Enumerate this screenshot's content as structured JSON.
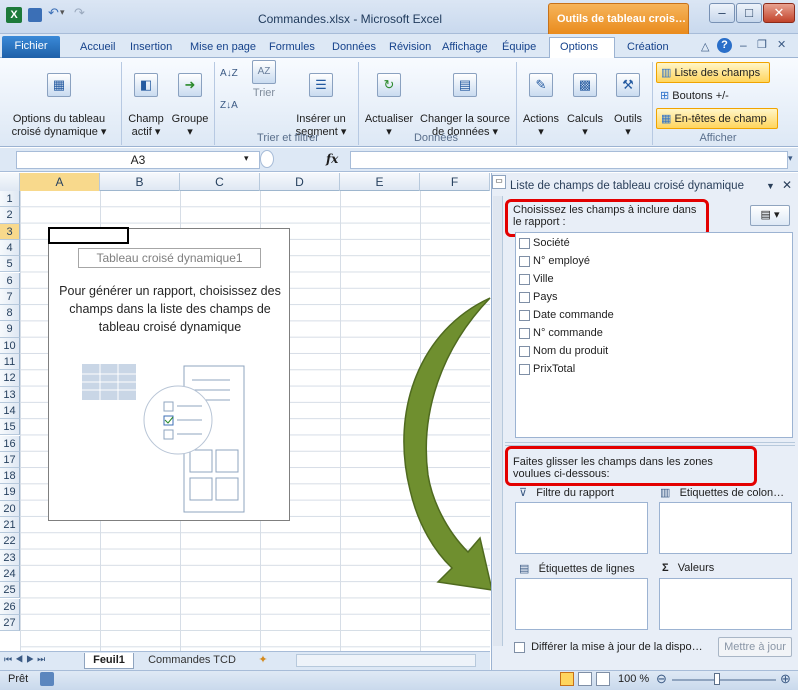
{
  "window": {
    "title": "Commandes.xlsx - Microsoft Excel",
    "context_tab": "Outils de tableau crois…"
  },
  "tabs": [
    "Fichier",
    "Accueil",
    "Insertion",
    "Mise en page",
    "Formules",
    "Données",
    "Révision",
    "Affichage",
    "Équipe",
    "Options",
    "Création"
  ],
  "ribbon": {
    "btn_options": "Options du tableau\ncroisé dynamique ▾",
    "btn_champ": "Champ\nactif ▾",
    "btn_groupe": "Groupe\n▾",
    "btn_trier": "Trier",
    "btn_segment": "Insérer un\nsegment ▾",
    "btn_actualiser": "Actualiser\n▾",
    "btn_changer": "Changer la source\nde données ▾",
    "btn_actions": "Actions\n▾",
    "btn_calculs": "Calculs\n▾",
    "btn_outils": "Outils\n▾",
    "btn_liste": "Liste des champs",
    "btn_boutons": "Boutons +/-",
    "btn_entetes": "En-têtes de champ",
    "group_trier": "Trier et filtrer",
    "group_donnees": "Données",
    "group_afficher": "Afficher"
  },
  "formula_bar": {
    "name_box": "A3",
    "fx": "fx",
    "value": ""
  },
  "columns": [
    "A",
    "B",
    "C",
    "D",
    "E",
    "F"
  ],
  "rows": [
    "1",
    "2",
    "3",
    "4",
    "5",
    "6",
    "7",
    "8",
    "9",
    "10",
    "11",
    "12",
    "13",
    "14",
    "15",
    "16",
    "17",
    "18",
    "19",
    "20",
    "21",
    "22",
    "23",
    "24",
    "25",
    "26",
    "27"
  ],
  "pivot": {
    "name": "Tableau croisé dynamique1",
    "instruction": "Pour générer un rapport, choisissez des champs dans la liste des champs de tableau croisé dynamique"
  },
  "sheets": {
    "active": "Feuil1",
    "other": "Commandes TCD"
  },
  "status": {
    "ready": "Prêt",
    "zoom": "100 %"
  },
  "panel": {
    "title": "Liste de champs de tableau croisé dynamique",
    "choose_label": "Choisissez les champs à inclure dans le rapport :",
    "fields": [
      "Société",
      "N° employé",
      "Ville",
      "Pays",
      "Date commande",
      "N° commande",
      "Nom du produit",
      "PrixTotal"
    ],
    "drag_label": "Faites glisser les champs dans les zones voulues ci-dessous:",
    "zone_filter": "Filtre du rapport",
    "zone_columns": "Etiquettes de colon…",
    "zone_rows": "Étiquettes de lignes",
    "zone_values": "Valeurs",
    "defer_label": "Différer la mise à jour de la dispo…",
    "update_button": "Mettre à jour"
  },
  "colors": {
    "accent_red": "#e30000",
    "arrow_green": "#6f8f2f",
    "context_orange": "#e98b1d"
  }
}
